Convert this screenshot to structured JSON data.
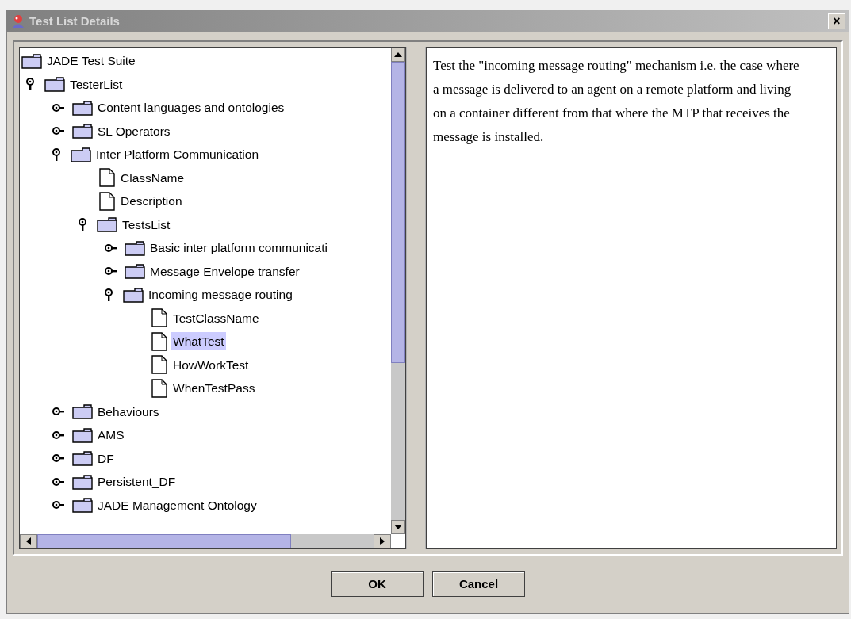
{
  "window": {
    "title": "Test List Details",
    "close": "×"
  },
  "tree": [
    {
      "label": "JADE Test Suite",
      "kind": "folder",
      "selected": false,
      "children": [
        {
          "label": "TesterList",
          "kind": "folder",
          "expanded": true,
          "selected": false,
          "children": [
            {
              "label": "Content languages and ontologies",
              "kind": "folder",
              "expanded": false,
              "selected": false
            },
            {
              "label": "SL Operators",
              "kind": "folder",
              "expanded": false,
              "selected": false
            },
            {
              "label": "Inter Platform Communication",
              "kind": "folder",
              "expanded": true,
              "selected": false,
              "children": [
                {
                  "label": "ClassName",
                  "kind": "file",
                  "selected": false
                },
                {
                  "label": "Description",
                  "kind": "file",
                  "selected": false
                },
                {
                  "label": "TestsList",
                  "kind": "folder",
                  "expanded": true,
                  "selected": false,
                  "children": [
                    {
                      "label": "Basic inter platform communicati",
                      "kind": "folder",
                      "expanded": false,
                      "selected": false
                    },
                    {
                      "label": "Message Envelope transfer",
                      "kind": "folder",
                      "expanded": false,
                      "selected": false
                    },
                    {
                      "label": "Incoming message routing",
                      "kind": "folder",
                      "expanded": true,
                      "selected": false,
                      "children": [
                        {
                          "label": "TestClassName",
                          "kind": "file",
                          "selected": false
                        },
                        {
                          "label": "WhatTest",
                          "kind": "file",
                          "selected": true
                        },
                        {
                          "label": "HowWorkTest",
                          "kind": "file",
                          "selected": false
                        },
                        {
                          "label": "WhenTestPass",
                          "kind": "file",
                          "selected": false
                        }
                      ]
                    }
                  ]
                }
              ]
            },
            {
              "label": "Behaviours",
              "kind": "folder",
              "expanded": false,
              "selected": false
            },
            {
              "label": "AMS",
              "kind": "folder",
              "expanded": false,
              "selected": false
            },
            {
              "label": "DF",
              "kind": "folder",
              "expanded": false,
              "selected": false
            },
            {
              "label": "Persistent_DF",
              "kind": "folder",
              "expanded": false,
              "selected": false
            },
            {
              "label": "JADE Management Ontology",
              "kind": "folder",
              "expanded": false,
              "selected": false
            }
          ]
        }
      ]
    }
  ],
  "description": "Test the \"incoming message routing\" mechanism i.e. the case where a message is delivered to an agent on a remote platform and living on a container different from that where the MTP that receives the message is installed.",
  "buttons": [
    "OK",
    "Cancel"
  ]
}
